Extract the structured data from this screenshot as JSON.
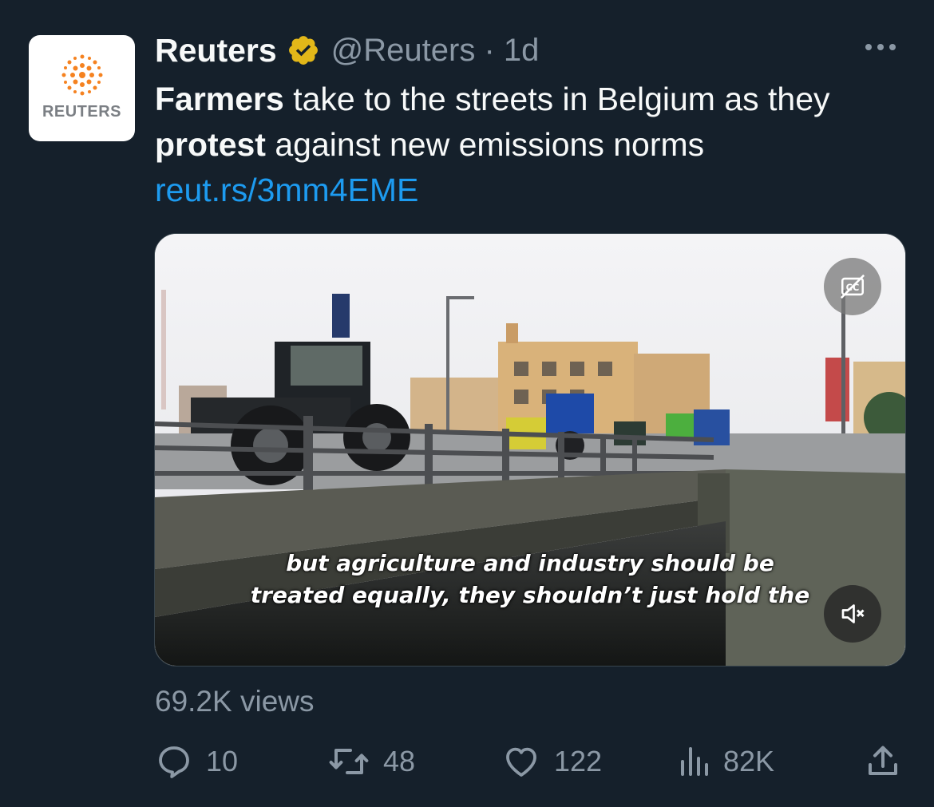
{
  "account": {
    "name": "Reuters",
    "handle_time": "@Reuters · 1d",
    "avatar_wordmark": "REUTERS",
    "verified_icon": "verified-badge-icon",
    "brand_color": "#f58220",
    "verified_color": "#e2b719"
  },
  "tweet": {
    "bold1": "Farmers",
    "text1": " take to the streets in Belgium as they ",
    "bold2": "protest",
    "text2": " against new emissions norms ",
    "link": "reut.rs/3mm4EME"
  },
  "video": {
    "subtitle_line1": "but agriculture and industry should be",
    "subtitle_line2": "treated equally, they shouldn’t just hold the",
    "cc_icon": "closed-captions-off-icon",
    "mute_icon": "muted-speaker-icon"
  },
  "stats": {
    "views": "69.2K views",
    "replies": "10",
    "retweets": "48",
    "likes": "122",
    "analytics": "82K"
  },
  "colors": {
    "background": "#15202b",
    "secondary_text": "#8b98a5",
    "link": "#1d9bf0"
  }
}
